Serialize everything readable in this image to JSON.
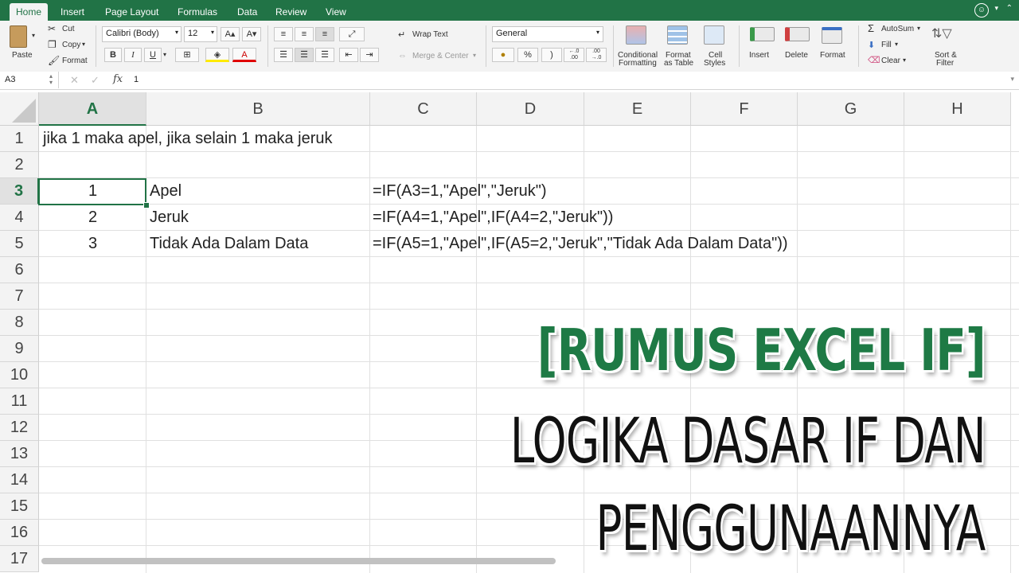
{
  "tabs": [
    "Home",
    "Insert",
    "Page Layout",
    "Formulas",
    "Data",
    "Review",
    "View"
  ],
  "active_tab": "Home",
  "ribbon": {
    "paste": "Paste",
    "cut": "Cut",
    "copy": "Copy",
    "format": "Format",
    "font_name": "Calibri (Body)",
    "font_size": "12",
    "bold": "B",
    "italic": "I",
    "underline": "U",
    "wrap_text": "Wrap Text",
    "merge_center": "Merge & Center",
    "number_format": "General",
    "percent": "%",
    "comma": ")",
    "inc_decimal": "←.0 .00",
    "dec_decimal": ".00 →.0",
    "conditional_formatting_1": "Conditional",
    "conditional_formatting_2": "Formatting",
    "format_as_table_1": "Format",
    "format_as_table_2": "as Table",
    "cell_styles_1": "Cell",
    "cell_styles_2": "Styles",
    "insert": "Insert",
    "delete": "Delete",
    "format_cells": "Format",
    "autosum": "AutoSum",
    "fill": "Fill",
    "clear": "Clear",
    "sort_filter_1": "Sort &",
    "sort_filter_2": "Filter"
  },
  "formula_bar": {
    "name_box": "A3",
    "fx": "fx",
    "content": "1"
  },
  "columns": [
    "A",
    "B",
    "C",
    "D",
    "E",
    "F",
    "G",
    "H"
  ],
  "rows": [
    "1",
    "2",
    "3",
    "4",
    "5",
    "6",
    "7",
    "8",
    "9",
    "10",
    "11",
    "12",
    "13",
    "14",
    "15",
    "16",
    "17"
  ],
  "cells": {
    "A1": "jika 1 maka apel, jika selain 1 maka jeruk",
    "A3": "1",
    "B3": "Apel",
    "C3": "=IF(A3=1,\"Apel\",\"Jeruk\")",
    "A4": "2",
    "B4": "Jeruk",
    "C4": "=IF(A4=1,\"Apel\",IF(A4=2,\"Jeruk\"))",
    "A5": "3",
    "B5": "Tidak Ada Dalam Data",
    "C5": "=IF(A5=1,\"Apel\",IF(A5=2,\"Jeruk\",\"Tidak Ada Dalam Data\"))"
  },
  "overlay": {
    "line1": "[RUMUS EXCEL IF]",
    "line2": "LOGIKA DASAR IF DAN",
    "line3": "PENGGUNAANNYA"
  },
  "colors": {
    "excel_green": "#217346",
    "title_green": "#1e7a45"
  }
}
